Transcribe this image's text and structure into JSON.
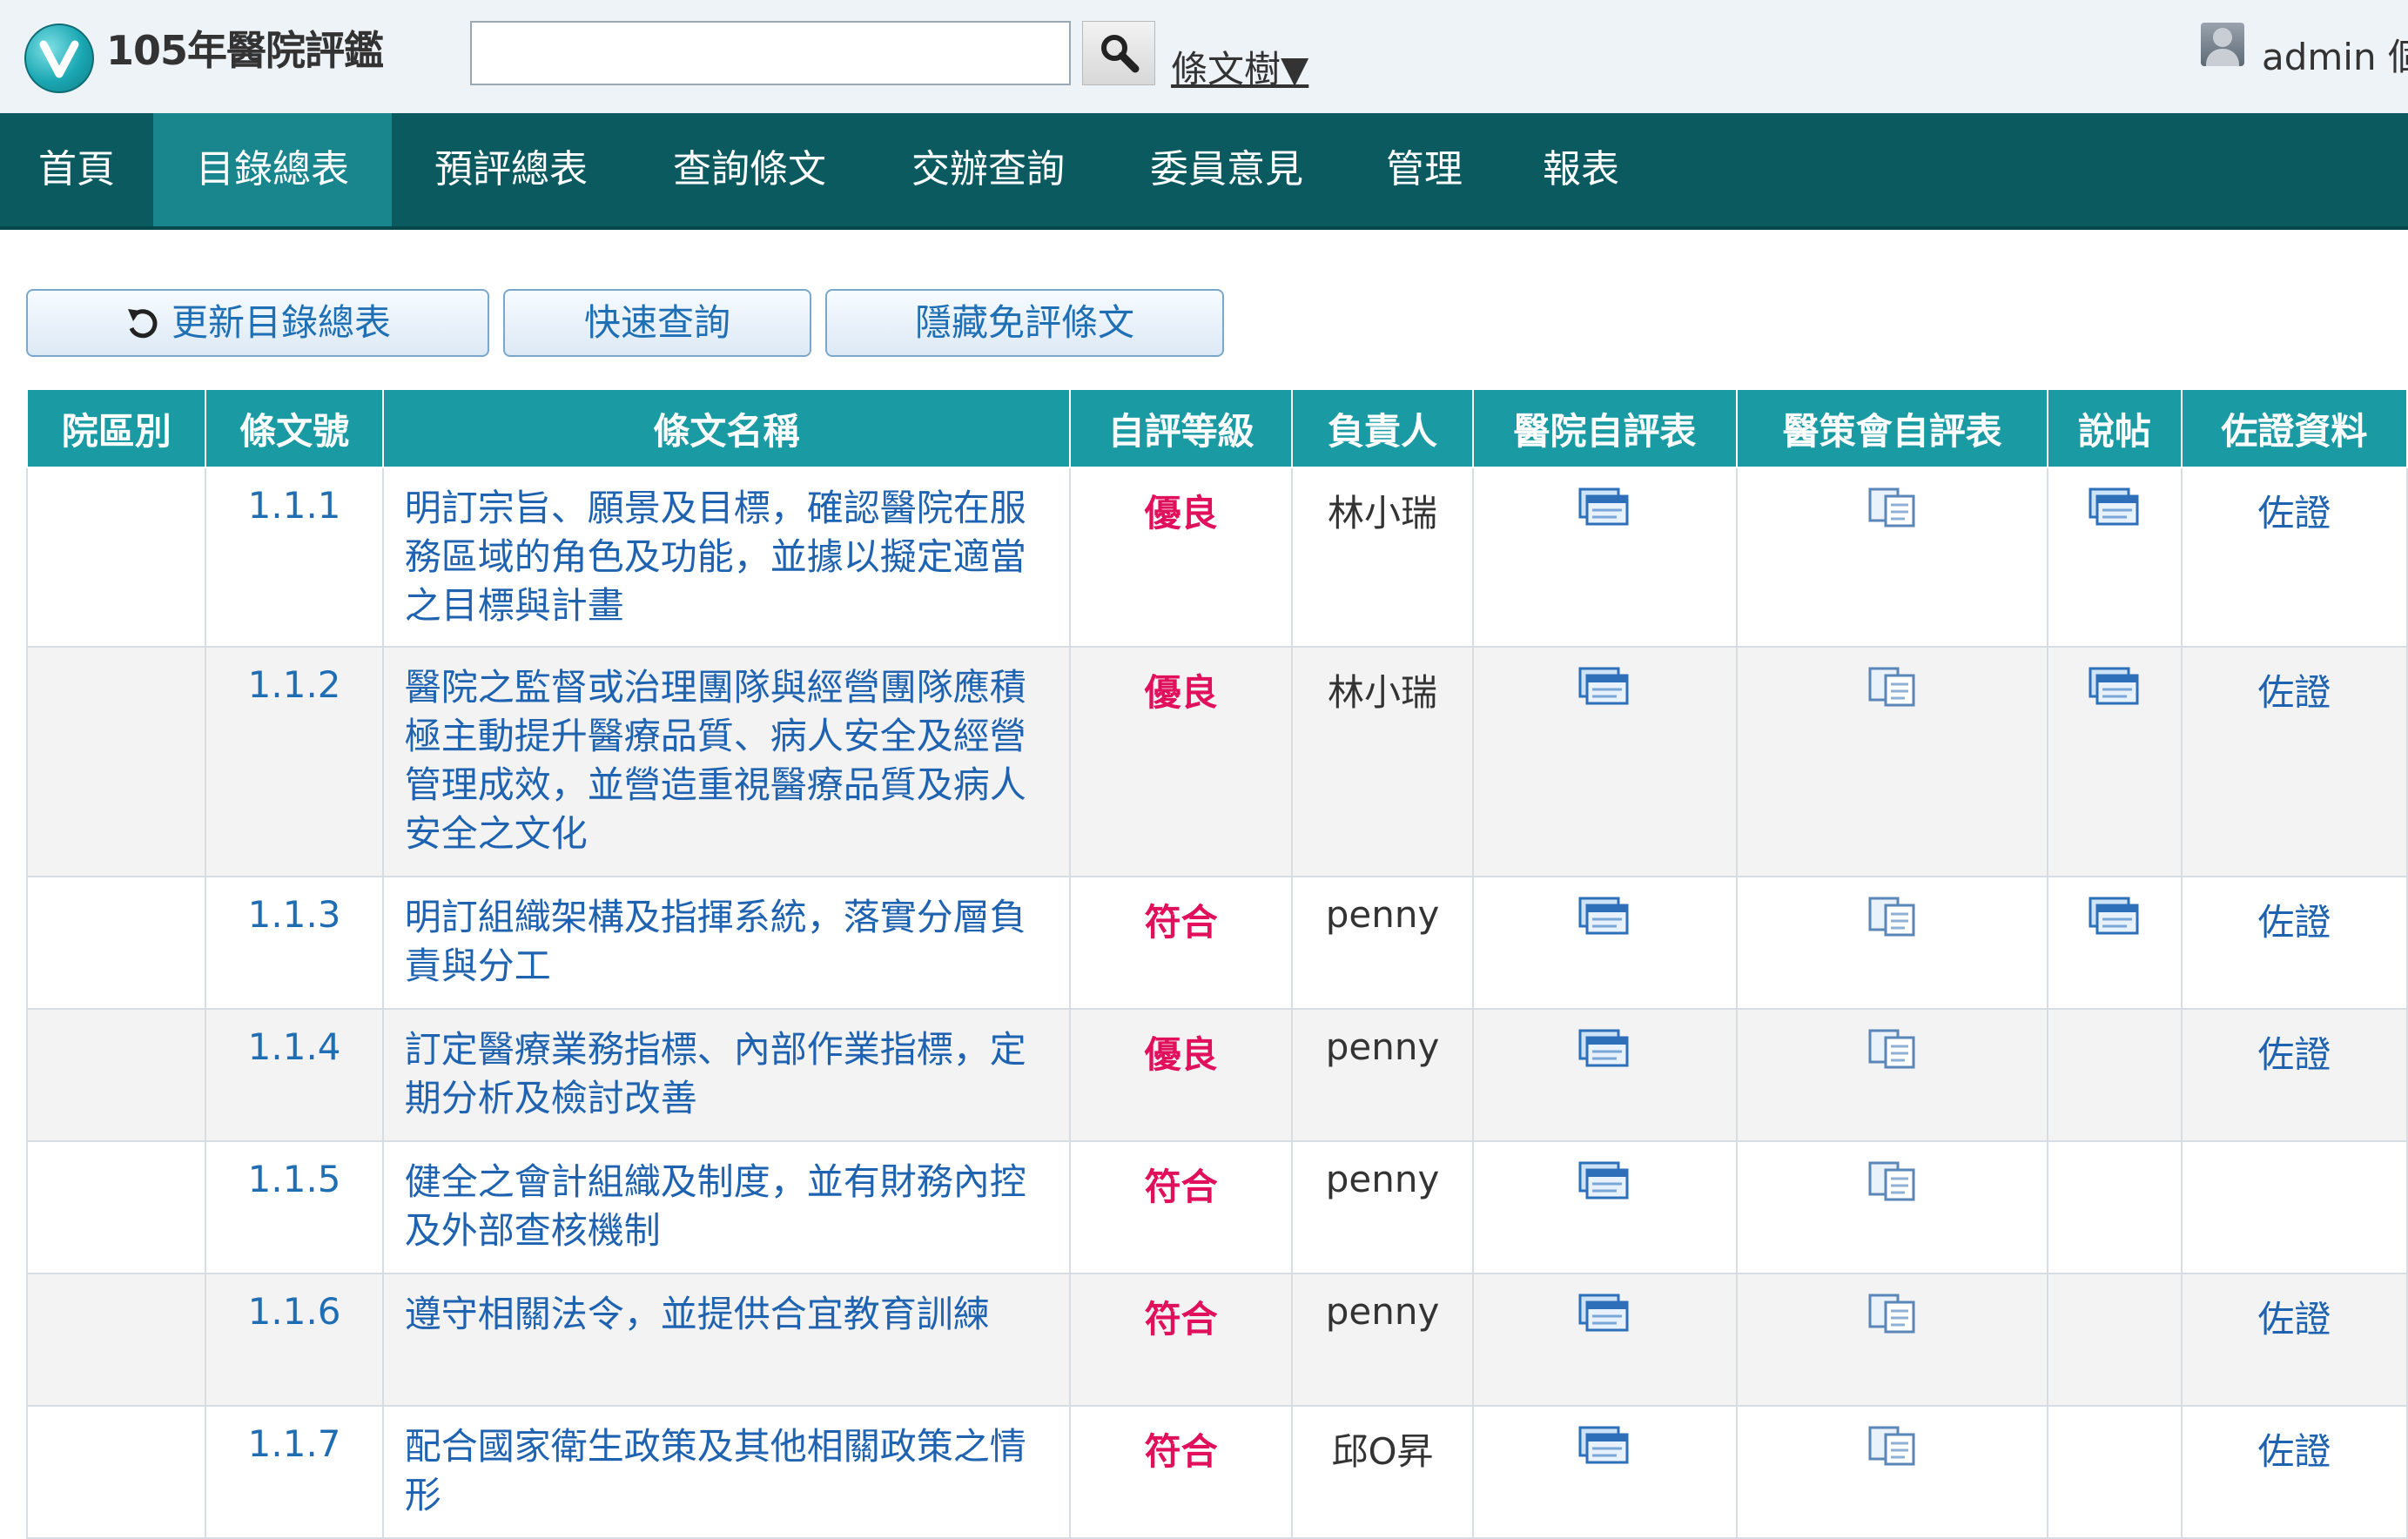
{
  "header": {
    "app_title": "105年醫院評鑑",
    "search": {
      "value": "",
      "placeholder": ""
    },
    "tree_link": "條文樹▼",
    "user_name": "admin 個"
  },
  "nav": {
    "items": [
      {
        "label": "首頁",
        "active": false
      },
      {
        "label": "目錄總表",
        "active": true
      },
      {
        "label": "預評總表",
        "active": false
      },
      {
        "label": "查詢條文",
        "active": false
      },
      {
        "label": "交辦查詢",
        "active": false
      },
      {
        "label": "委員意見",
        "active": false
      },
      {
        "label": "管理",
        "active": false
      },
      {
        "label": "報表",
        "active": false
      }
    ]
  },
  "toolbar": {
    "refresh_label": "更新目錄總表",
    "quick_query_label": "快速查詢",
    "hide_exempt_label": "隱藏免評條文"
  },
  "table": {
    "headers": [
      "院區別",
      "條文號",
      "條文名稱",
      "自評等級",
      "負責人",
      "醫院自評表",
      "醫策會自評表",
      "說帖",
      "佐證資料"
    ],
    "rows": [
      {
        "area": "",
        "num": "1.1.1",
        "name": "明訂宗旨、願景及目標，確認醫院在服務區域的角色及功能，並據以擬定適當之目標與計畫",
        "grade": "優良",
        "owner": "林小瑞",
        "hospital_form": true,
        "jct_form": true,
        "brief": true,
        "evidence": "佐證"
      },
      {
        "area": "",
        "num": "1.1.2",
        "name": "醫院之監督或治理團隊與經營團隊應積極主動提升醫療品質、病人安全及經營管理成效，並營造重視醫療品質及病人安全之文化",
        "grade": "優良",
        "owner": "林小瑞",
        "hospital_form": true,
        "jct_form": true,
        "brief": true,
        "evidence": "佐證"
      },
      {
        "area": "",
        "num": "1.1.3",
        "name": "明訂組織架構及指揮系統，落實分層負責與分工",
        "grade": "符合",
        "owner": "penny",
        "hospital_form": true,
        "jct_form": true,
        "brief": true,
        "evidence": "佐證"
      },
      {
        "area": "",
        "num": "1.1.4",
        "name": "訂定醫療業務指標、內部作業指標，定期分析及檢討改善",
        "grade": "優良",
        "owner": "penny",
        "hospital_form": true,
        "jct_form": true,
        "brief": false,
        "evidence": "佐證"
      },
      {
        "area": "",
        "num": "1.1.5",
        "name": "健全之會計組織及制度，並有財務內控及外部查核機制",
        "grade": "符合",
        "owner": "penny",
        "hospital_form": true,
        "jct_form": true,
        "brief": false,
        "evidence": ""
      },
      {
        "area": "",
        "num": "1.1.6",
        "name": "遵守相關法令，並提供合宜教育訓練",
        "grade": "符合",
        "owner": "penny",
        "hospital_form": true,
        "jct_form": true,
        "brief": false,
        "evidence": "佐證"
      },
      {
        "area": "",
        "num": "1.1.7",
        "name": "配合國家衛生政策及其他相關政策之情形",
        "grade": "符合",
        "owner": "邱O昇",
        "hospital_form": true,
        "jct_form": true,
        "brief": false,
        "evidence": "佐證"
      }
    ]
  },
  "colors": {
    "nav_bg": "#0b5a60",
    "nav_active": "#19868e",
    "table_header": "#1a9aa3",
    "link": "#1f63b0",
    "grade": "#e0105c"
  },
  "icons": {
    "logo": "v-logo-icon",
    "search": "magnifier-icon",
    "refresh": "refresh-icon",
    "hospital_form": "form-stack-icon",
    "jct_form": "copy-doc-icon",
    "brief": "form-stack-icon"
  }
}
